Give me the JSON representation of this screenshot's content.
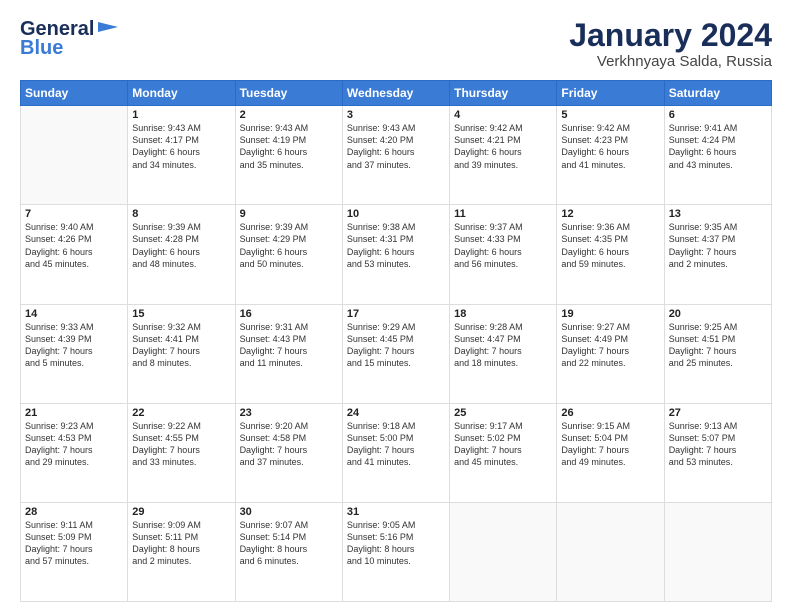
{
  "header": {
    "logo_line1": "General",
    "logo_line2": "Blue",
    "month_title": "January 2024",
    "location": "Verkhnyaya Salda, Russia"
  },
  "days_of_week": [
    "Sunday",
    "Monday",
    "Tuesday",
    "Wednesday",
    "Thursday",
    "Friday",
    "Saturday"
  ],
  "weeks": [
    [
      {
        "num": "",
        "info": ""
      },
      {
        "num": "1",
        "info": "Sunrise: 9:43 AM\nSunset: 4:17 PM\nDaylight: 6 hours\nand 34 minutes."
      },
      {
        "num": "2",
        "info": "Sunrise: 9:43 AM\nSunset: 4:19 PM\nDaylight: 6 hours\nand 35 minutes."
      },
      {
        "num": "3",
        "info": "Sunrise: 9:43 AM\nSunset: 4:20 PM\nDaylight: 6 hours\nand 37 minutes."
      },
      {
        "num": "4",
        "info": "Sunrise: 9:42 AM\nSunset: 4:21 PM\nDaylight: 6 hours\nand 39 minutes."
      },
      {
        "num": "5",
        "info": "Sunrise: 9:42 AM\nSunset: 4:23 PM\nDaylight: 6 hours\nand 41 minutes."
      },
      {
        "num": "6",
        "info": "Sunrise: 9:41 AM\nSunset: 4:24 PM\nDaylight: 6 hours\nand 43 minutes."
      }
    ],
    [
      {
        "num": "7",
        "info": "Sunrise: 9:40 AM\nSunset: 4:26 PM\nDaylight: 6 hours\nand 45 minutes."
      },
      {
        "num": "8",
        "info": "Sunrise: 9:39 AM\nSunset: 4:28 PM\nDaylight: 6 hours\nand 48 minutes."
      },
      {
        "num": "9",
        "info": "Sunrise: 9:39 AM\nSunset: 4:29 PM\nDaylight: 6 hours\nand 50 minutes."
      },
      {
        "num": "10",
        "info": "Sunrise: 9:38 AM\nSunset: 4:31 PM\nDaylight: 6 hours\nand 53 minutes."
      },
      {
        "num": "11",
        "info": "Sunrise: 9:37 AM\nSunset: 4:33 PM\nDaylight: 6 hours\nand 56 minutes."
      },
      {
        "num": "12",
        "info": "Sunrise: 9:36 AM\nSunset: 4:35 PM\nDaylight: 6 hours\nand 59 minutes."
      },
      {
        "num": "13",
        "info": "Sunrise: 9:35 AM\nSunset: 4:37 PM\nDaylight: 7 hours\nand 2 minutes."
      }
    ],
    [
      {
        "num": "14",
        "info": "Sunrise: 9:33 AM\nSunset: 4:39 PM\nDaylight: 7 hours\nand 5 minutes."
      },
      {
        "num": "15",
        "info": "Sunrise: 9:32 AM\nSunset: 4:41 PM\nDaylight: 7 hours\nand 8 minutes."
      },
      {
        "num": "16",
        "info": "Sunrise: 9:31 AM\nSunset: 4:43 PM\nDaylight: 7 hours\nand 11 minutes."
      },
      {
        "num": "17",
        "info": "Sunrise: 9:29 AM\nSunset: 4:45 PM\nDaylight: 7 hours\nand 15 minutes."
      },
      {
        "num": "18",
        "info": "Sunrise: 9:28 AM\nSunset: 4:47 PM\nDaylight: 7 hours\nand 18 minutes."
      },
      {
        "num": "19",
        "info": "Sunrise: 9:27 AM\nSunset: 4:49 PM\nDaylight: 7 hours\nand 22 minutes."
      },
      {
        "num": "20",
        "info": "Sunrise: 9:25 AM\nSunset: 4:51 PM\nDaylight: 7 hours\nand 25 minutes."
      }
    ],
    [
      {
        "num": "21",
        "info": "Sunrise: 9:23 AM\nSunset: 4:53 PM\nDaylight: 7 hours\nand 29 minutes."
      },
      {
        "num": "22",
        "info": "Sunrise: 9:22 AM\nSunset: 4:55 PM\nDaylight: 7 hours\nand 33 minutes."
      },
      {
        "num": "23",
        "info": "Sunrise: 9:20 AM\nSunset: 4:58 PM\nDaylight: 7 hours\nand 37 minutes."
      },
      {
        "num": "24",
        "info": "Sunrise: 9:18 AM\nSunset: 5:00 PM\nDaylight: 7 hours\nand 41 minutes."
      },
      {
        "num": "25",
        "info": "Sunrise: 9:17 AM\nSunset: 5:02 PM\nDaylight: 7 hours\nand 45 minutes."
      },
      {
        "num": "26",
        "info": "Sunrise: 9:15 AM\nSunset: 5:04 PM\nDaylight: 7 hours\nand 49 minutes."
      },
      {
        "num": "27",
        "info": "Sunrise: 9:13 AM\nSunset: 5:07 PM\nDaylight: 7 hours\nand 53 minutes."
      }
    ],
    [
      {
        "num": "28",
        "info": "Sunrise: 9:11 AM\nSunset: 5:09 PM\nDaylight: 7 hours\nand 57 minutes."
      },
      {
        "num": "29",
        "info": "Sunrise: 9:09 AM\nSunset: 5:11 PM\nDaylight: 8 hours\nand 2 minutes."
      },
      {
        "num": "30",
        "info": "Sunrise: 9:07 AM\nSunset: 5:14 PM\nDaylight: 8 hours\nand 6 minutes."
      },
      {
        "num": "31",
        "info": "Sunrise: 9:05 AM\nSunset: 5:16 PM\nDaylight: 8 hours\nand 10 minutes."
      },
      {
        "num": "",
        "info": ""
      },
      {
        "num": "",
        "info": ""
      },
      {
        "num": "",
        "info": ""
      }
    ]
  ]
}
